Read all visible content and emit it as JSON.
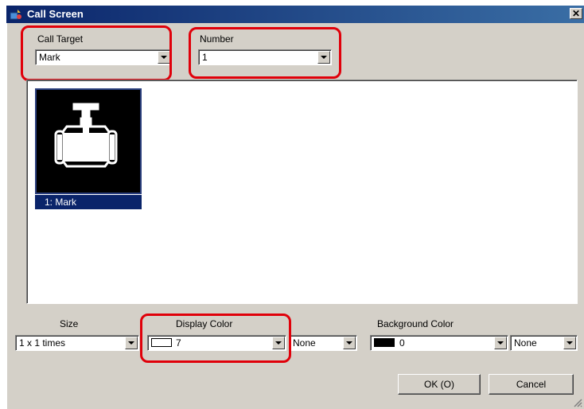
{
  "window": {
    "title": "Call Screen",
    "close_label": "✕"
  },
  "call_target": {
    "label": "Call Target",
    "value": "Mark"
  },
  "number": {
    "label": "Number",
    "value": "1"
  },
  "preview": {
    "item_caption": "1: Mark",
    "icon": "valve-icon"
  },
  "size": {
    "label": "Size",
    "value": "1 x 1 times"
  },
  "display_color": {
    "label": "Display Color",
    "value": "7",
    "blink_value": "None",
    "swatch_color": "#ffffff"
  },
  "background_color": {
    "label": "Background Color",
    "value": "0",
    "blink_value": "None",
    "swatch_color": "#000000"
  },
  "buttons": {
    "ok": "OK (O)",
    "cancel": "Cancel"
  },
  "colors": {
    "title_start": "#0a246a",
    "title_end": "#3a6ea5",
    "highlight": "#e0000a",
    "selection": "#0a246a"
  }
}
